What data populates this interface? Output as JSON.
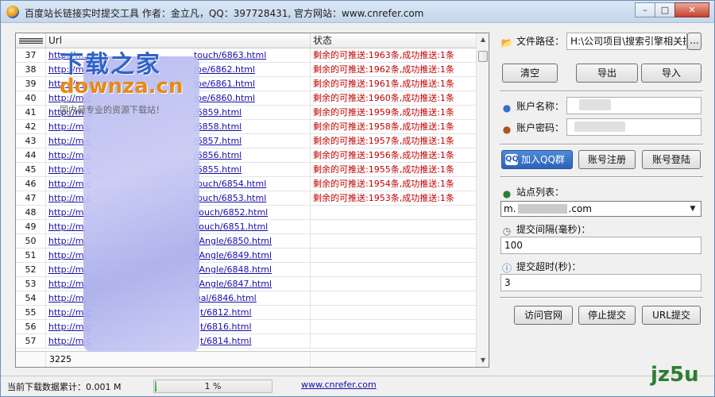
{
  "window": {
    "title": "百度站长链接实时提交工具 作者：金立凡，QQ：397728431, 官方网站：www.cnrefer.com",
    "controls": [
      "–",
      "□",
      "✕"
    ]
  },
  "table": {
    "columns": {
      "url": "Url",
      "status": "状态"
    },
    "rows": [
      {
        "num": "37",
        "url": "http://m.c",
        "url_tail": "touch/6863.html",
        "status": "剩余的可推送:1963条,成功推送:1条"
      },
      {
        "num": "38",
        "url": "http://m.c",
        "url_tail": "ipe/6862.html",
        "status": "剩余的可推送:1962条,成功推送:1条"
      },
      {
        "num": "39",
        "url": "http://m.c",
        "url_tail": "ipe/6861.html",
        "status": "剩余的可推送:1961条,成功推送:1条"
      },
      {
        "num": "40",
        "url": "http://m.c",
        "url_tail": "ipe/6860.html",
        "status": "剩余的可推送:1960条,成功推送:1条"
      },
      {
        "num": "41",
        "url": "http://m.c",
        "url_tail": "/6859.html",
        "status": "剩余的可推送:1959条,成功推送:1条"
      },
      {
        "num": "42",
        "url": "http://m.c",
        "url_tail": "/6858.html",
        "status": "剩余的可推送:1958条,成功推送:1条"
      },
      {
        "num": "43",
        "url": "http://m.c",
        "url_tail": "/6857.html",
        "status": "剩余的可推送:1957条,成功推送:1条"
      },
      {
        "num": "44",
        "url": "http://m.c",
        "url_tail": "/6856.html",
        "status": "剩余的可推送:1956条,成功推送:1条"
      },
      {
        "num": "45",
        "url": "http://m.c",
        "url_tail": "/6855.html",
        "status": "剩余的可推送:1955条,成功推送:1条"
      },
      {
        "num": "46",
        "url": "http://m.c",
        "url_tail": "touch/6854.html",
        "status": "剩余的可推送:1954条,成功推送:1条"
      },
      {
        "num": "47",
        "url": "http://m.c",
        "url_tail": "touch/6853.html",
        "status": "剩余的可推送:1953条,成功推送:1条"
      },
      {
        "num": "48",
        "url": "http://m.",
        "url_tail": "touch/6852.html",
        "status": ""
      },
      {
        "num": "49",
        "url": "http://m.",
        "url_tail": "touch/6851.html",
        "status": ""
      },
      {
        "num": "50",
        "url": "http://m.",
        "url_tail": "rAngle/6850.html",
        "status": ""
      },
      {
        "num": "51",
        "url": "http://m.",
        "url_tail": "rAngle/6849.html",
        "status": ""
      },
      {
        "num": "52",
        "url": "http://m.",
        "url_tail": "rAngle/6848.html",
        "status": ""
      },
      {
        "num": "53",
        "url": "http://m.",
        "url_tail": "rAngle/6847.html",
        "status": ""
      },
      {
        "num": "54",
        "url": "http://m.",
        "url_tail": "eal/6846.html",
        "status": ""
      },
      {
        "num": "55",
        "url": "http://m.c",
        "url_tail": "t/6812.html",
        "status": ""
      },
      {
        "num": "56",
        "url": "http://m.c",
        "url_tail": "t/6816.html",
        "status": ""
      },
      {
        "num": "57",
        "url": "http://m.c",
        "url_tail": "t/6814.html",
        "status": ""
      }
    ],
    "footer_count": "3225"
  },
  "watermark": {
    "cn": "下载之家",
    "en": "downza.cn",
    "sub": "国内最专业的资源下载站！"
  },
  "panel": {
    "file_path_label": "文件路径：",
    "file_path_value": "H:\\公司项目\\搜索引擎相关搜",
    "browse_label": "...",
    "clear_button": "清空",
    "export_button": "导出",
    "import_button": "导入",
    "account_name_label": "账户名称：",
    "account_password_label": "账户密码：",
    "qq_group_button": "加入QQ群",
    "register_button": "账号注册",
    "login_button": "账号登陆",
    "site_list_label": "站点列表：",
    "site_list_value": "m.",
    "site_list_tail": ".com",
    "interval_label": "提交间隔(毫秒)：",
    "interval_value": "100",
    "timeout_label": "提交超时(秒)：",
    "timeout_value": "3",
    "visit_site_button": "访问官网",
    "stop_button": "停止提交",
    "url_submit_button": "URL提交"
  },
  "statusbar": {
    "download_text": "当前下载数据累计：0.001 M",
    "progress_percent": 1,
    "progress_text": "1 %",
    "link_text": "www.cnrefer.com"
  },
  "logo_text": "jz5u"
}
